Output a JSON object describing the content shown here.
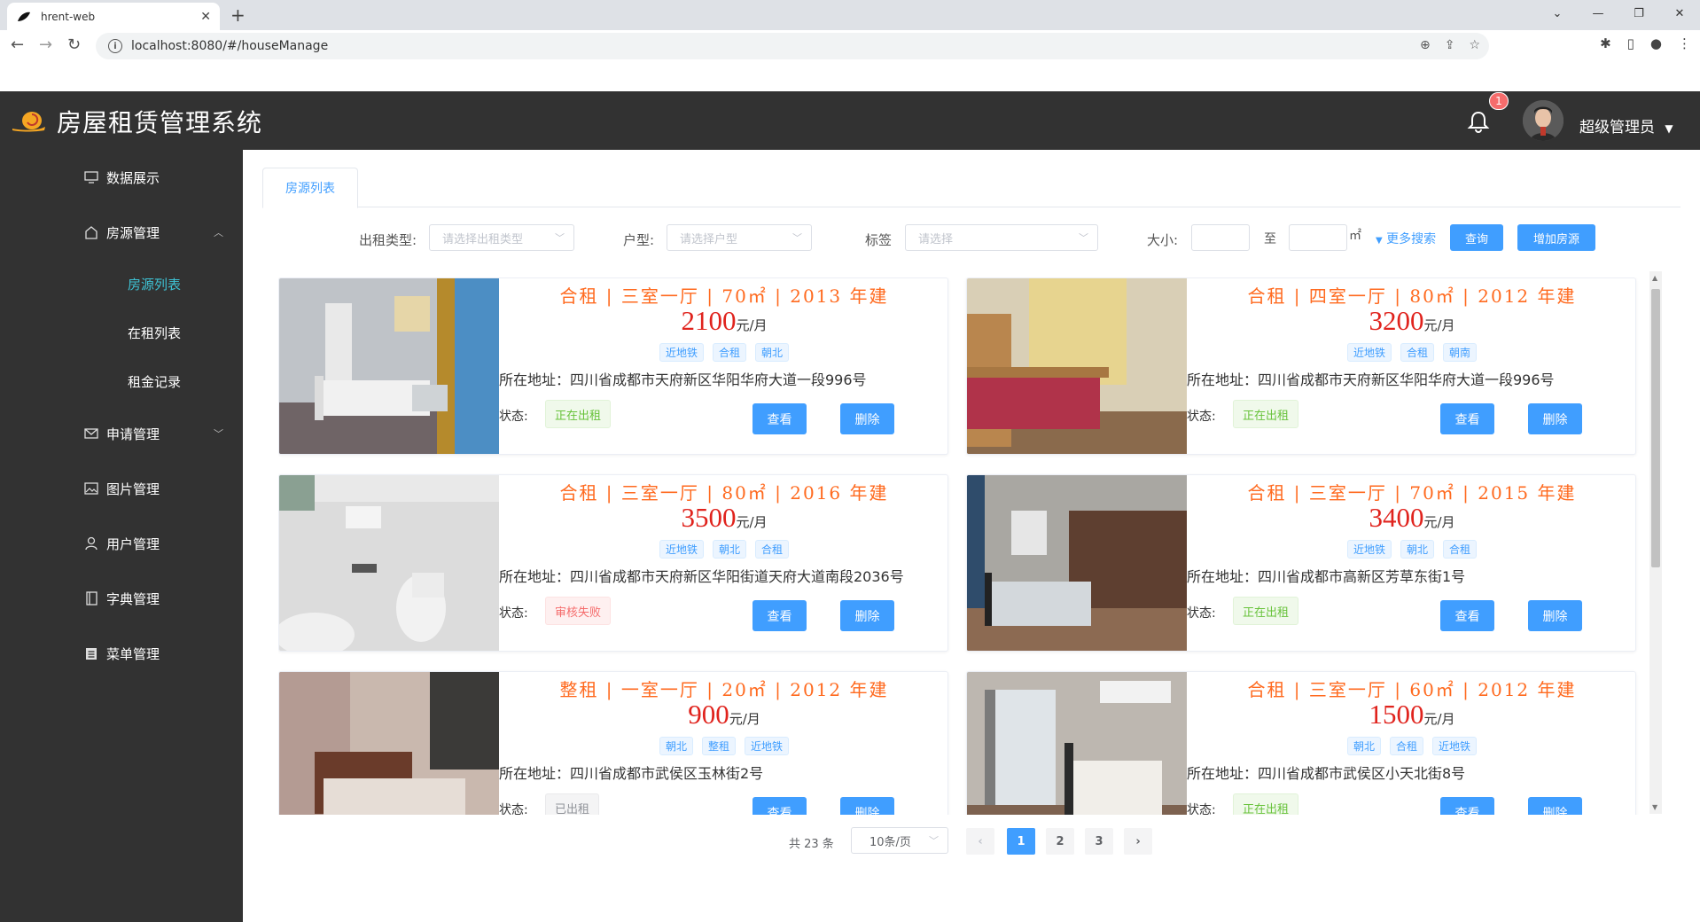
{
  "browser": {
    "tab_title": "hrent-web",
    "url": "localhost:8080/#/houseManage"
  },
  "header": {
    "title": "房屋租赁管理系统",
    "notification_count": "1",
    "user_name": "超级管理员"
  },
  "sidebar": {
    "items": [
      {
        "label": "数据展示",
        "icon": "monitor-icon"
      },
      {
        "label": "房源管理",
        "icon": "home-icon",
        "expanded": true
      },
      {
        "label": "申请管理",
        "icon": "message-icon"
      },
      {
        "label": "图片管理",
        "icon": "picture-icon"
      },
      {
        "label": "用户管理",
        "icon": "user-icon"
      },
      {
        "label": "字典管理",
        "icon": "notebook-icon"
      },
      {
        "label": "菜单管理",
        "icon": "list-icon"
      }
    ],
    "sub_items": [
      {
        "label": "房源列表",
        "active": true
      },
      {
        "label": "在租列表"
      },
      {
        "label": "租金记录"
      }
    ]
  },
  "main": {
    "tab_label": "房源列表",
    "filters": {
      "rent_type_label": "出租类型:",
      "rent_type_placeholder": "请选择出租类型",
      "layout_label": "户型:",
      "layout_placeholder": "请选择户型",
      "tags_label": "标签",
      "tags_placeholder": "请选择",
      "size_label": "大小:",
      "size_to": "至",
      "size_unit": "㎡",
      "more_search": "更多搜索",
      "query_button": "查询",
      "add_button": "增加房源"
    },
    "cards": [
      {
        "title": "合租 | 三室一厅 | 70㎡ | 2013 年建",
        "price": "2100",
        "price_unit": "元/月",
        "tags": [
          "近地铁",
          "合租",
          "朝北"
        ],
        "address": "所在地址：四川省成都市天府新区华阳华府大道一段996号",
        "status": "正在出租",
        "status_color": "green"
      },
      {
        "title": "合租 | 四室一厅 | 80㎡ | 2012 年建",
        "price": "3200",
        "price_unit": "元/月",
        "tags": [
          "近地铁",
          "合租",
          "朝南"
        ],
        "address": "所在地址：四川省成都市天府新区华阳华府大道一段996号",
        "status": "正在出租",
        "status_color": "green"
      },
      {
        "title": "合租 | 三室一厅 | 80㎡ | 2016 年建",
        "price": "3500",
        "price_unit": "元/月",
        "tags": [
          "近地铁",
          "朝北",
          "合租"
        ],
        "address": "所在地址：四川省成都市天府新区华阳街道天府大道南段2036号",
        "status": "审核失败",
        "status_color": "red"
      },
      {
        "title": "合租 | 三室一厅 | 70㎡ | 2015 年建",
        "price": "3400",
        "price_unit": "元/月",
        "tags": [
          "近地铁",
          "朝北",
          "合租"
        ],
        "address": "所在地址：四川省成都市高新区芳草东街1号",
        "status": "正在出租",
        "status_color": "green"
      },
      {
        "title": "整租 | 一室一厅 | 20㎡ | 2012 年建",
        "price": "900",
        "price_unit": "元/月",
        "tags": [
          "朝北",
          "整租",
          "近地铁"
        ],
        "address": "所在地址：四川省成都市武侯区玉林街2号",
        "status": "已出租",
        "status_color": "gray"
      },
      {
        "title": "合租 | 三室一厅 | 60㎡ | 2012 年建",
        "price": "1500",
        "price_unit": "元/月",
        "tags": [
          "朝北",
          "合租",
          "近地铁"
        ],
        "address": "所在地址：四川省成都市武侯区小天北街8号",
        "status": "正在出租",
        "status_color": "green"
      }
    ],
    "card_labels": {
      "status_label": "状态:",
      "view_button": "查看",
      "delete_button": "删除"
    },
    "pagination": {
      "total": "共 23 条",
      "page_size": "10条/页",
      "pages": [
        "1",
        "2",
        "3"
      ],
      "current": "1"
    }
  },
  "colors": {
    "header_bg": "#323232",
    "accent": "#409eff",
    "active_menu": "#3ec1d3",
    "title_orange": "#ff6a1f",
    "price_red": "#e0231d"
  }
}
